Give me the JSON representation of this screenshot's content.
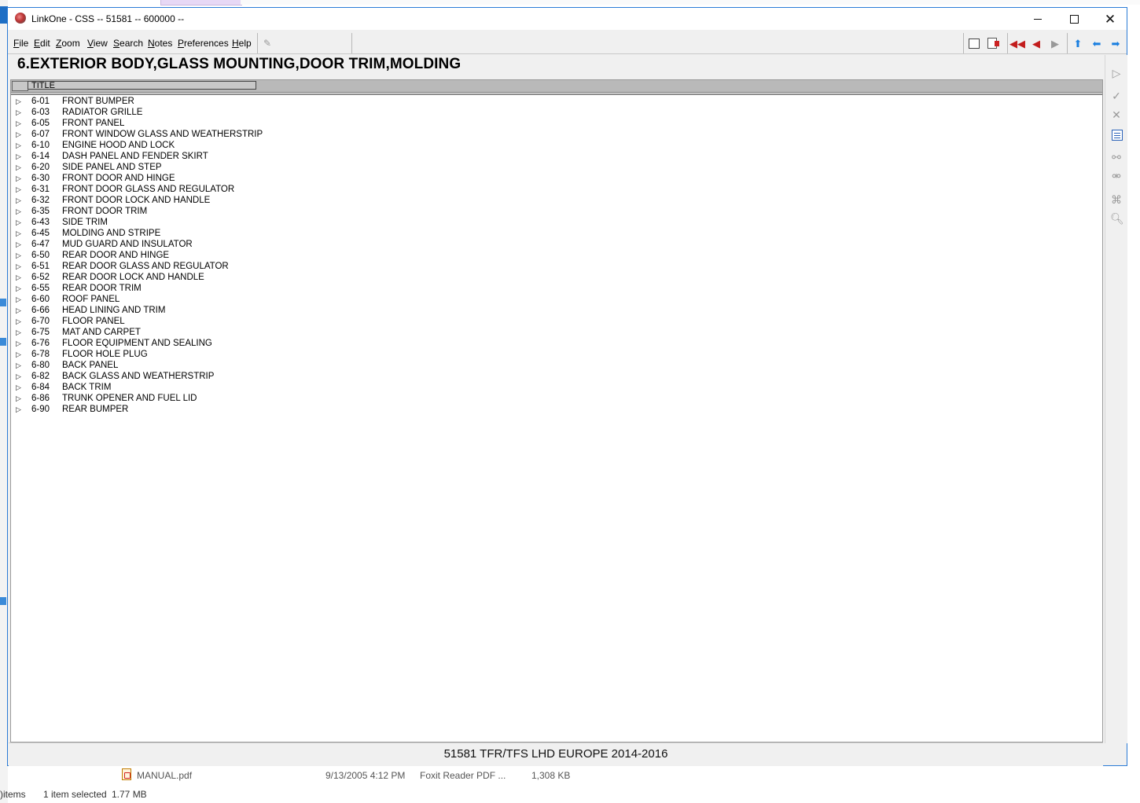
{
  "window": {
    "title": "LinkOne - CSS -- 51581 -- 600000 --"
  },
  "menu": {
    "items": [
      "File",
      "Edit",
      "Zoom",
      "View",
      "Search",
      "Notes",
      "Preferences",
      "Help"
    ]
  },
  "page": {
    "title": "6.EXTERIOR BODY,GLASS MOUNTING,DOOR TRIM,MOLDING",
    "column_header": "TITLE",
    "rows": [
      {
        "code": "6-01",
        "name": "FRONT BUMPER"
      },
      {
        "code": "6-03",
        "name": "RADIATOR GRILLE"
      },
      {
        "code": "6-05",
        "name": "FRONT PANEL"
      },
      {
        "code": "6-07",
        "name": "FRONT WINDOW GLASS AND WEATHERSTRIP"
      },
      {
        "code": "6-10",
        "name": "ENGINE HOOD AND LOCK"
      },
      {
        "code": "6-14",
        "name": "DASH PANEL AND FENDER SKIRT"
      },
      {
        "code": "6-20",
        "name": "SIDE PANEL AND STEP"
      },
      {
        "code": "6-30",
        "name": "FRONT DOOR AND HINGE"
      },
      {
        "code": "6-31",
        "name": "FRONT DOOR GLASS AND REGULATOR"
      },
      {
        "code": "6-32",
        "name": "FRONT DOOR LOCK AND HANDLE"
      },
      {
        "code": "6-35",
        "name": "FRONT DOOR TRIM"
      },
      {
        "code": "6-43",
        "name": "SIDE TRIM"
      },
      {
        "code": "6-45",
        "name": "MOLDING AND STRIPE"
      },
      {
        "code": "6-47",
        "name": "MUD GUARD AND INSULATOR"
      },
      {
        "code": "6-50",
        "name": "REAR DOOR AND HINGE"
      },
      {
        "code": "6-51",
        "name": "REAR DOOR GLASS AND REGULATOR"
      },
      {
        "code": "6-52",
        "name": "REAR DOOR LOCK AND HANDLE"
      },
      {
        "code": "6-55",
        "name": "REAR DOOR TRIM"
      },
      {
        "code": "6-60",
        "name": "ROOF PANEL"
      },
      {
        "code": "6-66",
        "name": "HEAD LINING AND TRIM"
      },
      {
        "code": "6-70",
        "name": "FLOOR PANEL"
      },
      {
        "code": "6-75",
        "name": "MAT AND CARPET"
      },
      {
        "code": "6-76",
        "name": "FLOOR EQUIPMENT AND SEALING"
      },
      {
        "code": "6-78",
        "name": "FLOOR HOLE PLUG"
      },
      {
        "code": "6-80",
        "name": "BACK PANEL"
      },
      {
        "code": "6-82",
        "name": "BACK GLASS AND WEATHERSTRIP"
      },
      {
        "code": "6-84",
        "name": "BACK TRIM"
      },
      {
        "code": "6-86",
        "name": "TRUNK OPENER AND FUEL LID"
      },
      {
        "code": "6-90",
        "name": "REAR BUMPER"
      }
    ],
    "footer": "51581 TFR/TFS LHD EUROPE 2014-2016"
  },
  "background": {
    "file_name": "MANUAL.pdf",
    "file_date": "9/13/2005 4:12 PM",
    "file_type": "Foxit Reader PDF ...",
    "file_size": "1,308 KB",
    "status_items": ")items",
    "status_selected": "1 item selected",
    "status_size": "1.77 MB"
  },
  "colors": {
    "accent_border": "#2b7bd6",
    "nav_red": "#c21c1c",
    "nav_blue": "#1a7fe0"
  }
}
